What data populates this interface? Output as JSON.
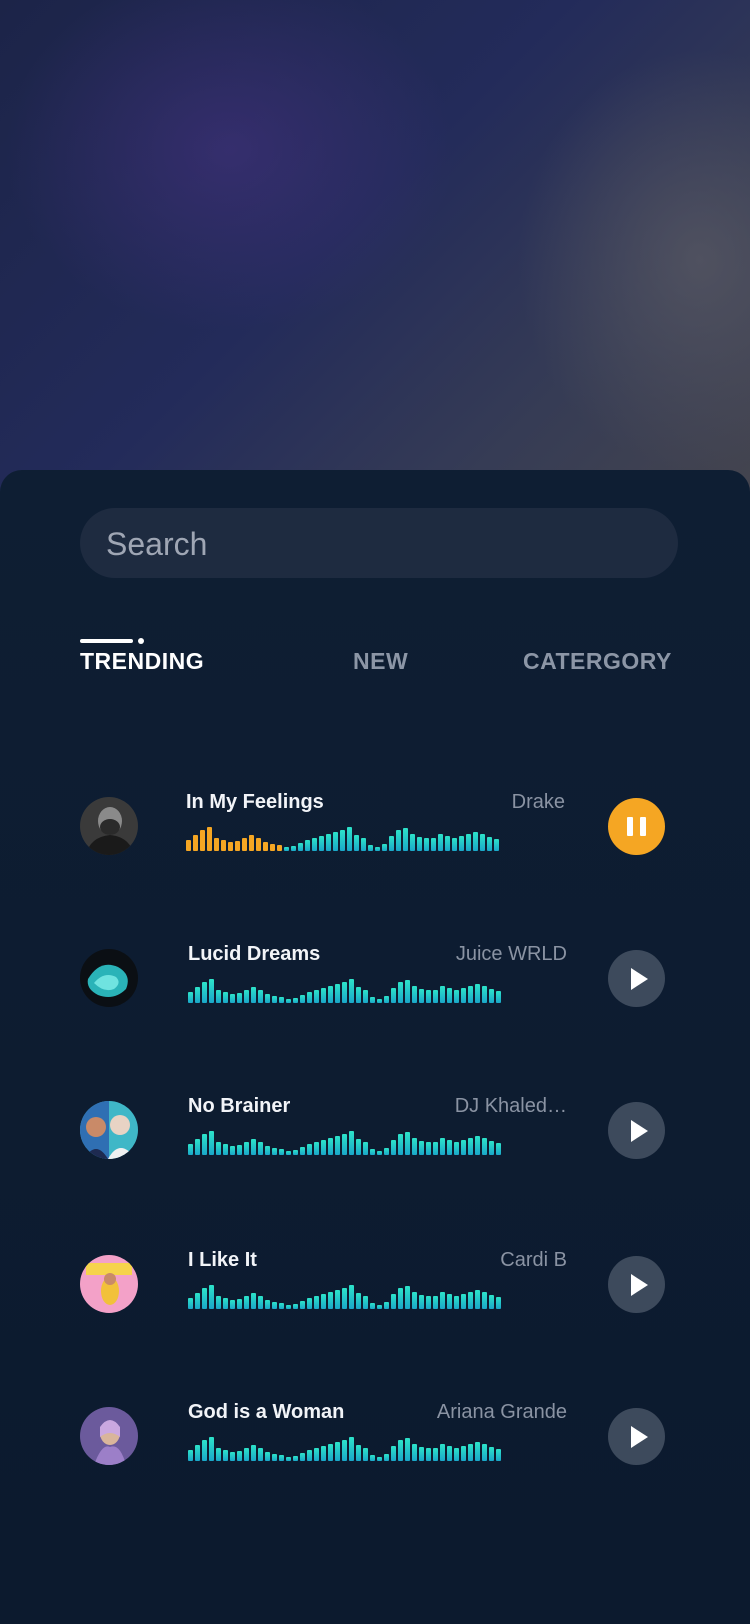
{
  "search": {
    "placeholder": "Search"
  },
  "tabs": [
    {
      "label": "TRENDING",
      "active": true
    },
    {
      "label": "NEW",
      "active": false
    },
    {
      "label": "CATERGORY",
      "active": false
    }
  ],
  "colors": {
    "accent": "#f5a623",
    "wave": "#2de3c9",
    "panel": "#0c1a2f"
  },
  "tracks": [
    {
      "title": "In My Feelings",
      "artist": "Drake",
      "state": "pause",
      "icon": "pause-icon",
      "progress": 0.3
    },
    {
      "title": "Lucid Dreams",
      "artist": "Juice WRLD",
      "state": "play",
      "icon": "play-icon",
      "progress": 0
    },
    {
      "title": "No Brainer",
      "artist": "DJ Khaled…",
      "state": "play",
      "icon": "play-icon",
      "progress": 0
    },
    {
      "title": "I Like It",
      "artist": "Cardi B",
      "state": "play",
      "icon": "play-icon",
      "progress": 0
    },
    {
      "title": "God is a Woman",
      "artist": "Ariana Grande",
      "state": "play",
      "icon": "play-icon",
      "progress": 0
    }
  ]
}
